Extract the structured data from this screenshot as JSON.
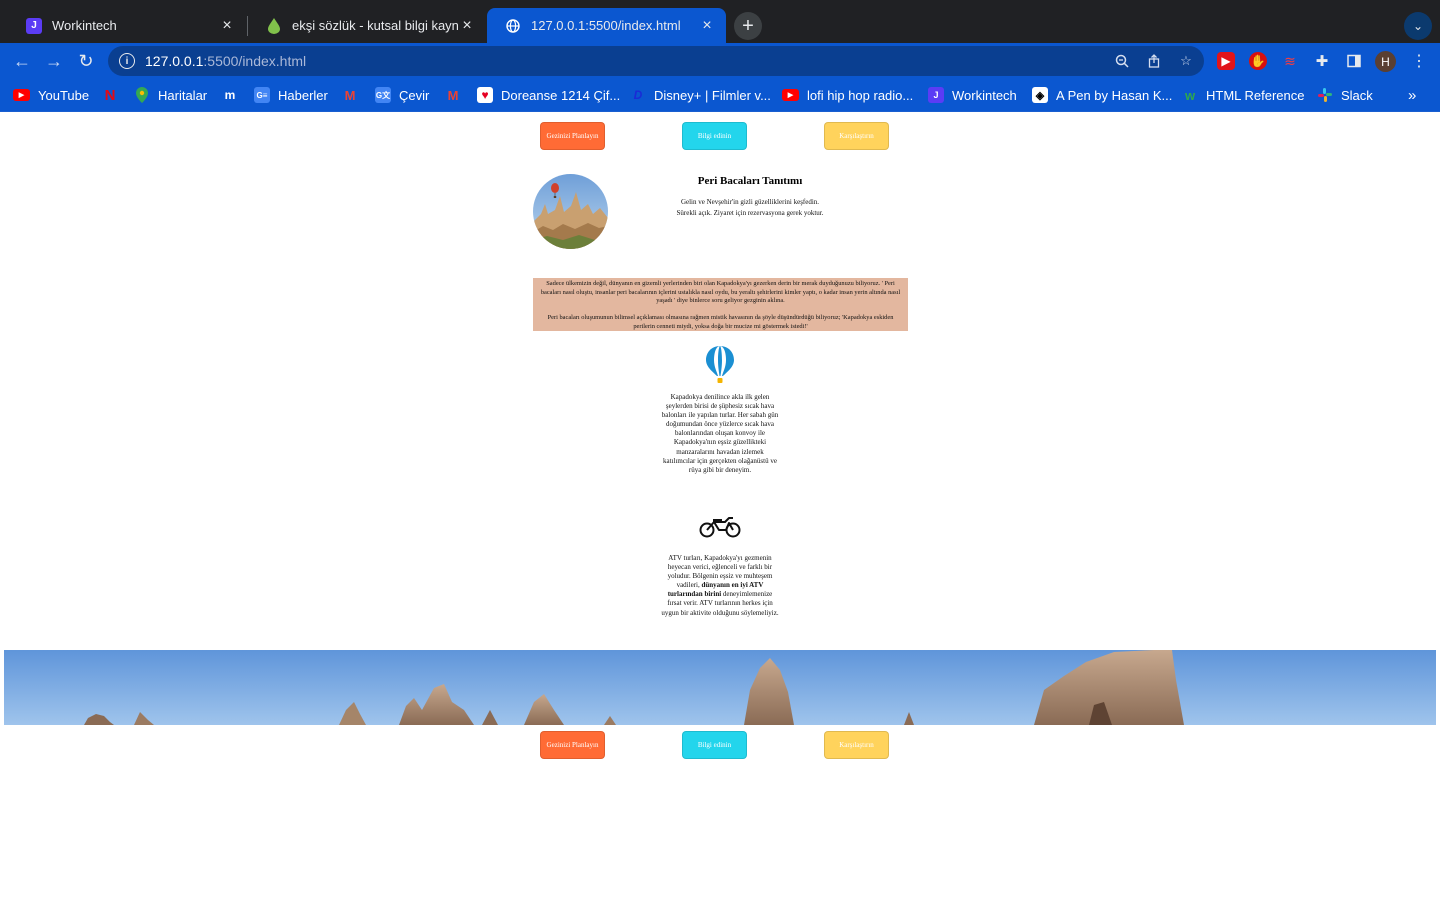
{
  "browser": {
    "tabs": [
      {
        "title": "Workintech",
        "favicon": "workintech-icon"
      },
      {
        "title": "ekşi sözlük - kutsal bilgi kaynağı",
        "favicon": "eksi-drop-icon"
      },
      {
        "title": "127.0.0.1:5500/index.html",
        "favicon": "globe-icon"
      }
    ],
    "address": {
      "host": "127.0.0.1",
      "path": ":5500/index.html"
    },
    "avatar_initial": "H",
    "bookmarks": [
      {
        "label": "YouTube",
        "icon": "youtube-icon"
      },
      {
        "label": "",
        "icon": "netflix-icon"
      },
      {
        "label": "Haritalar",
        "icon": "maps-icon"
      },
      {
        "label": "",
        "icon": "m-icon"
      },
      {
        "label": "Haberler",
        "icon": "news-icon"
      },
      {
        "label": "",
        "icon": "gmail-icon"
      },
      {
        "label": "Çevir",
        "icon": "translate-icon"
      },
      {
        "label": "",
        "icon": "gmail-icon"
      },
      {
        "label": "Doreanse 1214 Çif...",
        "icon": "heart-icon"
      },
      {
        "label": "Disney+ | Filmler v...",
        "icon": "disney-icon"
      },
      {
        "label": "lofi hip hop radio...",
        "icon": "youtube-icon"
      },
      {
        "label": "Workintech",
        "icon": "workintech-icon"
      },
      {
        "label": "A Pen by Hasan K...",
        "icon": "codepen-icon"
      },
      {
        "label": "HTML Reference",
        "icon": "w-icon"
      },
      {
        "label": "Slack",
        "icon": "slack-icon"
      }
    ]
  },
  "nav": {
    "plan_label": "Gezinizi Planlayın",
    "info_label": "Bilgi edinin",
    "compare_label": "Karşılaştırın"
  },
  "intro": {
    "title": "Peri Bacaları Tanıtımı",
    "line1": "Gelin ve Nevşehir'in gizli güzelliklerini keşfedin.",
    "line2": "Sürekli açık. Ziyaret için rezervasyona gerek yoktur."
  },
  "story": {
    "p1": "Sadece ülkemizin değil, dünyanın en gizemli yerlerinden biri olan Kapadokya'yı gezerken derin bir merak duyduğunuzu biliyoruz. ' Peri bacaları nasıl oluştu, insanlar peri bacalarının içlerini ustalıkla nasıl oydu, bu yeraltı şehirlerini kimler yaptı, o kadar insan yerin altında nasıl yaşadı ' diye binlerce soru geliyor gezginin aklına.",
    "p2": "Peri bacaları oluşumunun bilimsel açıklaması olmasına rağmen mistik havasının da şöyle düşündürdüğü biliyoruz; 'Kapadokya eskiden perilerin cenneti miydi, yoksa doğa bir mucize mi göstermek istedi!'"
  },
  "balloon_feature": {
    "icon": "hot-air-balloon-icon",
    "text": "Kapadokya denilince akla ilk gelen şeylerden birisi de şüphesiz sıcak hava balonları ile yapılan turlar. Her sabah gün doğumundan önce yüzlerce sıcak hava balonlarından oluşan konvoy ile Kapadokya'nın eşsiz güzellikteki manzaralarını havadan izlemek katılımcılar için gerçekten olağanüstü ve rüya gibi bir deneyim."
  },
  "atv_feature": {
    "icon": "motorcycle-icon",
    "text_before": "ATV turları, Kapadokya'yı gezmenin heyecan verici, eğlenceli ve farklı bir yoludur. Bölgenin eşsiz ve muhteşem vadileri,",
    "text_bold": "dünyanın en iyi ATV turlarından birini",
    "text_after": "deneyimlemenize fırsat verir. ATV turlarının herkes için uygun bir aktivite olduğunu söylemeliyiz."
  },
  "colors": {
    "chrome_blue": "#0b57d0",
    "tab_strip": "#202124",
    "button_orange": "#ff6b35",
    "button_cyan": "#23d5ec",
    "button_yellow": "#ffd35c",
    "story_bg": "#e3b79f"
  }
}
